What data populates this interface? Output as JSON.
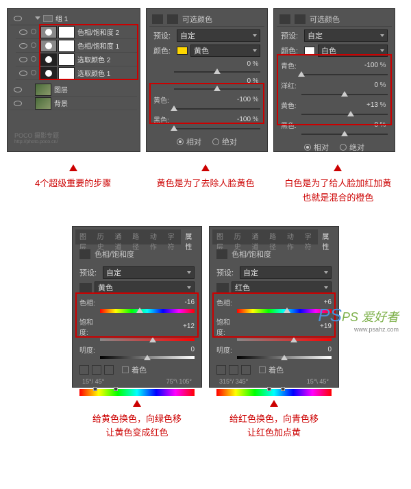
{
  "layers_panel": {
    "group_name": "组 1",
    "layers": [
      {
        "name": "色相/饱和度 2",
        "thumb": "grad"
      },
      {
        "name": "色相/饱和度 1",
        "thumb": "grad"
      },
      {
        "name": "选取颜色 2",
        "thumb": "half"
      },
      {
        "name": "选取颜色 1",
        "thumb": "half"
      }
    ],
    "extra_layers": [
      {
        "name": "图层",
        "thumb": "img"
      },
      {
        "name": "背景",
        "thumb": "img"
      }
    ],
    "watermark_line1": "POCO 摄影专题",
    "watermark_line2": "http://photo.poco.cn/"
  },
  "selcolor1": {
    "title": "可选颜色",
    "preset_label": "预设:",
    "preset_value": "自定",
    "color_label": "颜色:",
    "color_value": "黄色",
    "sliders": [
      {
        "label": "",
        "value": "0",
        "pct": "%",
        "pos": 50
      },
      {
        "label": "",
        "value": "0",
        "pct": "%",
        "pos": 50
      },
      {
        "label": "黄色:",
        "value": "-100",
        "pct": "%",
        "pos": 0
      },
      {
        "label": "黑色:",
        "value": "-100",
        "pct": "%",
        "pos": 0
      }
    ],
    "radio1": "相对",
    "radio2": "绝对"
  },
  "selcolor2": {
    "title": "可选颜色",
    "preset_label": "预设:",
    "preset_value": "自定",
    "color_label": "颜色:",
    "color_value": "白色",
    "sliders": [
      {
        "label": "青色:",
        "value": "-100",
        "pct": "%",
        "pos": 0
      },
      {
        "label": "洋红:",
        "value": "0",
        "pct": "%",
        "pos": 50
      },
      {
        "label": "黄色:",
        "value": "+13",
        "pct": "%",
        "pos": 57
      },
      {
        "label": "黑色:",
        "value": "0",
        "pct": "%",
        "pos": 50
      }
    ],
    "radio1": "相对",
    "radio2": "绝对"
  },
  "captions1": [
    "4个超级重要的步骤",
    "黄色是为了去除人脸黄色",
    "白色是为了给人脸加红加黄\n也就是混合的橙色"
  ],
  "hue1": {
    "tabs": [
      "图层",
      "历史",
      "通道",
      "路径",
      "动作",
      "字符",
      "属性"
    ],
    "title": "色相/饱和度",
    "preset_label": "预设:",
    "preset_value": "自定",
    "channel_value": "黄色",
    "sliders": [
      {
        "label": "色相:",
        "value": "-16",
        "pos": 42
      },
      {
        "label": "饱和度:",
        "value": "+12",
        "pos": 56
      },
      {
        "label": "明度:",
        "value": "0",
        "pos": 50
      }
    ],
    "colorize": "着色",
    "angles_left": "15°/ 45°",
    "angles_right": "75°\\ 105°"
  },
  "hue2": {
    "tabs": [
      "图层",
      "历史",
      "通道",
      "路径",
      "动作",
      "字符",
      "属性"
    ],
    "title": "色相/饱和度",
    "preset_label": "预设:",
    "preset_value": "自定",
    "channel_value": "红色",
    "sliders": [
      {
        "label": "色相:",
        "value": "+6",
        "pos": 53
      },
      {
        "label": "饱和度:",
        "value": "+19",
        "pos": 60
      },
      {
        "label": "明度:",
        "value": "0",
        "pos": 50
      }
    ],
    "colorize": "着色",
    "angles_left": "315°/ 345°",
    "angles_right": "15°\\ 45°"
  },
  "captions2": [
    "给黄色换色，向绿色移\n让黄色变成红色",
    "给红色换色，向青色移\n让红色加点黄"
  ],
  "ps_watermark": {
    "main": "PS 爱好者",
    "sub": "www.psahz.com"
  }
}
